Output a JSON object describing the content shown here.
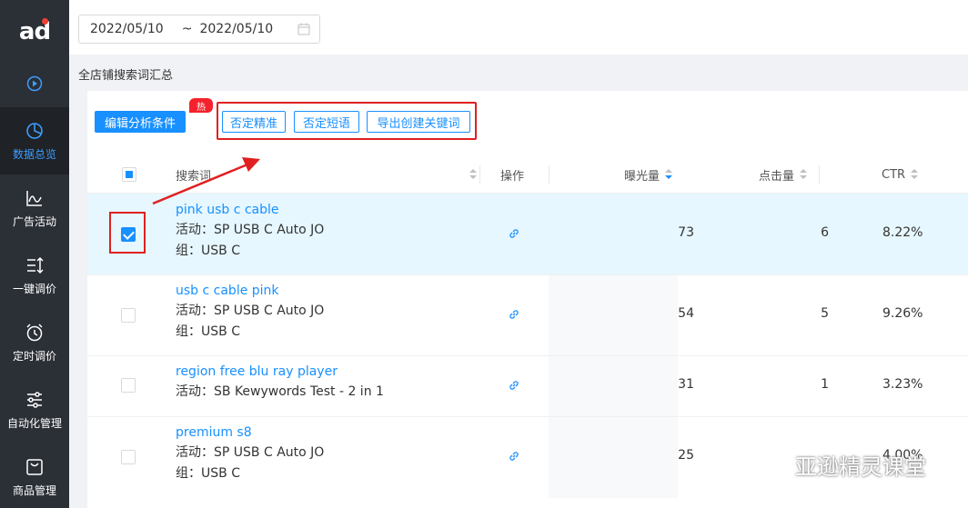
{
  "app": {
    "logo_text": "ad"
  },
  "sidebar": {
    "items": [
      {
        "label": "数据总览",
        "icon": "pie-chart-icon",
        "active": true
      },
      {
        "label": "广告活动",
        "icon": "line-chart-icon",
        "active": false
      },
      {
        "label": "一键调价",
        "icon": "sort-icon",
        "active": false
      },
      {
        "label": "定时调价",
        "icon": "alarm-clock-icon",
        "active": false
      },
      {
        "label": "自动化管理",
        "icon": "sliders-icon",
        "active": false
      },
      {
        "label": "商品管理",
        "icon": "shopping-bag-icon",
        "active": false
      }
    ]
  },
  "toolbar": {
    "date_start": "2022/05/10",
    "date_sep": "~",
    "date_end": "2022/05/10"
  },
  "section": {
    "title": "全店铺搜索词汇总"
  },
  "actions": {
    "edit_label": "编辑分析条件",
    "hot_badge": "热",
    "negate_exact": "否定精准",
    "negate_phrase": "否定短语",
    "export_keywords": "导出创建关键词"
  },
  "table": {
    "headers": {
      "search_term": "搜索词",
      "operation": "操作",
      "impressions": "曝光量",
      "clicks": "点击量",
      "ctr": "CTR"
    },
    "rows": [
      {
        "keyword": "pink usb c cable",
        "campaign": "活动：SP USB C Auto JO",
        "group": "组：USB C",
        "impressions": "73",
        "clicks": "6",
        "ctr": "8.22%",
        "checked": true
      },
      {
        "keyword": "usb c cable pink",
        "campaign": "活动：SP USB C Auto JO",
        "group": "组：USB C",
        "impressions": "54",
        "clicks": "5",
        "ctr": "9.26%",
        "checked": false
      },
      {
        "keyword": "region free blu ray player",
        "campaign": "活动：SB Kewywords Test - 2 in 1",
        "group": "",
        "impressions": "31",
        "clicks": "1",
        "ctr": "3.23%",
        "checked": false
      },
      {
        "keyword": "premium s8",
        "campaign": "活动：SP USB C Auto JO",
        "group": "组：USB C",
        "impressions": "25",
        "clicks": "",
        "ctr": "4.00%",
        "checked": false
      }
    ]
  },
  "watermark": {
    "text": "亚逊精灵课堂"
  },
  "colors": {
    "accent": "#1890ff",
    "sidebar_bg": "#2b2f36",
    "highlight": "#e02020"
  }
}
